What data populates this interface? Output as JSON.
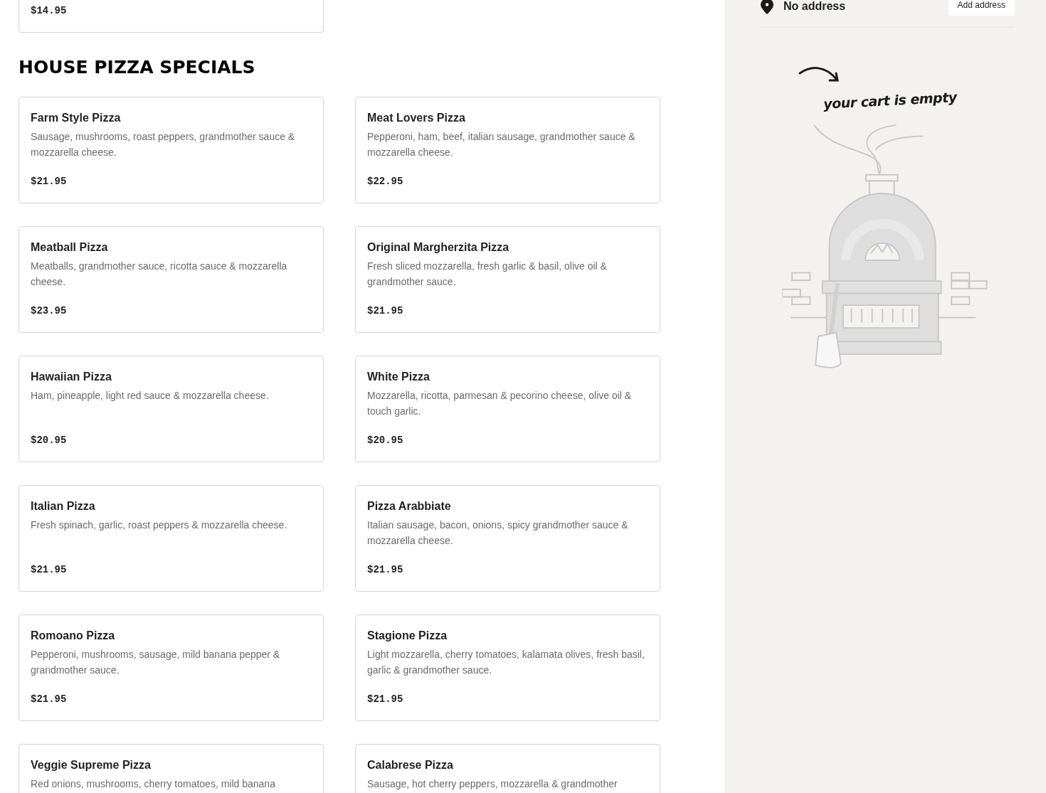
{
  "previous_item": {
    "price": "$14.95"
  },
  "section": {
    "title": "HOUSE PIZZA SPECIALS"
  },
  "items": [
    {
      "name": "Farm Style Pizza",
      "description": "Sausage, mushrooms, roast peppers, grandmother sauce & mozzarella cheese.",
      "price": "$21.95"
    },
    {
      "name": "Meat Lovers Pizza",
      "description": "Pepperoni, ham, beef, italian sausage, grandmother sauce & mozzarella cheese.",
      "price": "$22.95"
    },
    {
      "name": "Meatball Pizza",
      "description": "Meatballs, grandmother sauce, ricotta sauce & mozzarella cheese.",
      "price": "$23.95"
    },
    {
      "name": "Original Margherzita Pizza",
      "description": "Fresh sliced mozzarella, fresh garlic & basil, olive oil & grandmother sauce.",
      "price": "$21.95"
    },
    {
      "name": "Hawaiian Pizza",
      "description": "Ham, pineapple, light red sauce & mozzarella cheese.",
      "price": "$20.95"
    },
    {
      "name": "White Pizza",
      "description": "Mozzarella, ricotta, parmesan & pecorino cheese, olive oil & touch garlic.",
      "price": "$20.95"
    },
    {
      "name": "Italian Pizza",
      "description": "Fresh spinach, garlic, roast peppers & mozzarella cheese.",
      "price": "$21.95"
    },
    {
      "name": "Pizza Arabbiate",
      "description": "Italian sausage, bacon, onions, spicy grandmother sauce & mozzarella cheese.",
      "price": "$21.95"
    },
    {
      "name": "Romoano Pizza",
      "description": "Pepperoni, mushrooms, sausage, mild banana pepper & grandmother sauce.",
      "price": "$21.95"
    },
    {
      "name": "Stagione Pizza",
      "description": "Light mozzarella, cherry tomatoes, kalamata olives, fresh basil, garlic & grandmother sauce.",
      "price": "$21.95"
    },
    {
      "name": "Veggie Supreme Pizza",
      "description": "Red onions, mushrooms, cherry tomatoes, mild banana"
    },
    {
      "name": "Calabrese Pizza",
      "description": "Sausage, hot cherry peppers, mozzarella & grandmother"
    }
  ],
  "cart": {
    "address": "No address",
    "add_address_button": "Add address",
    "empty_message": "your cart is empty"
  }
}
